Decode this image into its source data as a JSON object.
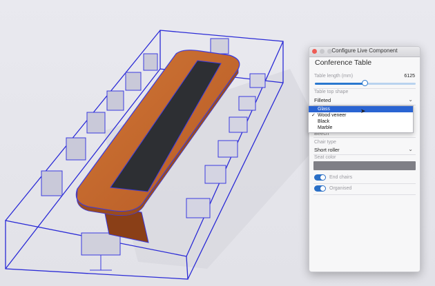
{
  "window": {
    "title": "Configure Live Component"
  },
  "component": {
    "title": "Conference Table"
  },
  "length": {
    "label": "Table length (mm)",
    "value": "6125",
    "fraction": 0.49
  },
  "shape": {
    "label": "Table top shape",
    "value": "Filleted"
  },
  "dropdown": {
    "options": [
      "Glass",
      "Wood veneer",
      "Black",
      "Marble"
    ],
    "highlighted": 0,
    "checked": 1
  },
  "hidden_value": "Beech",
  "chair": {
    "label": "Chair type",
    "value": "Short roller"
  },
  "seat": {
    "label": "Seat color",
    "color": "#7f7f86"
  },
  "toggles": {
    "end_chairs": "End chairs",
    "organised": "Organised"
  },
  "colors": {
    "accent": "#2a6fc6",
    "wireframe": "#2a2ad6",
    "wood": "#c4652b",
    "glass": "#2d2f33"
  }
}
